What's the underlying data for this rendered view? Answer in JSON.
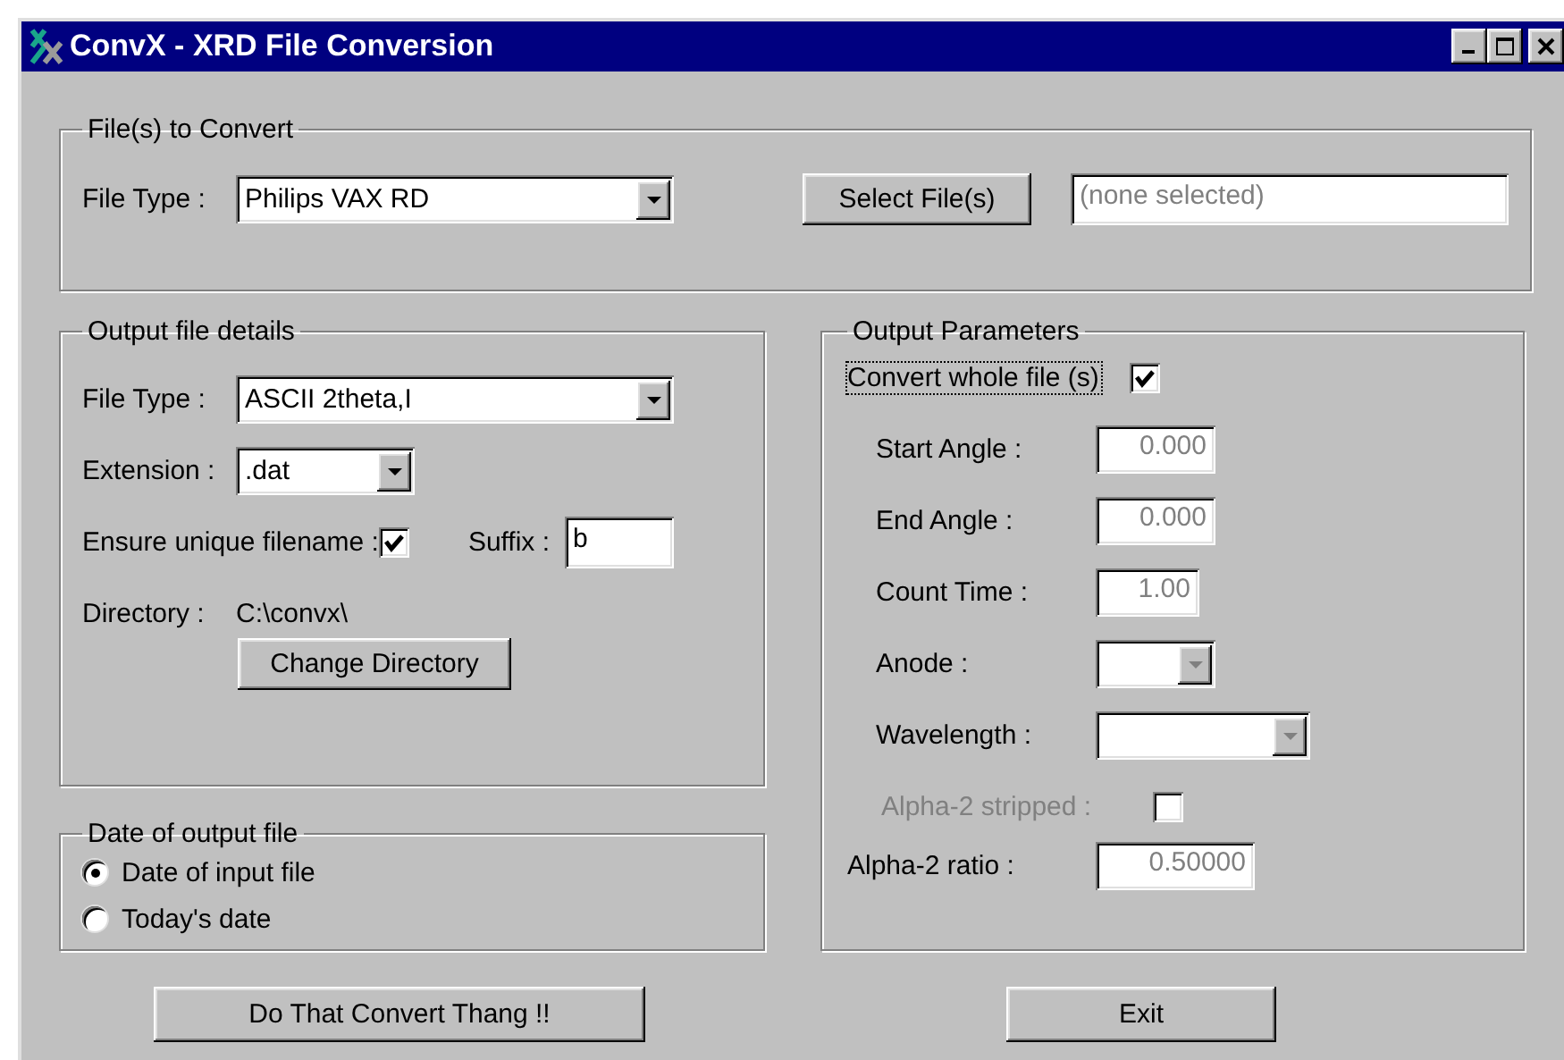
{
  "window": {
    "title": "ConvX - XRD File Conversion"
  },
  "files_to_convert": {
    "title": "File(s) to Convert",
    "file_type": {
      "label": "File Type :",
      "value": "Philips VAX RD"
    },
    "select_button": "Select File(s)",
    "selected_files": {
      "value": "(none selected)",
      "disabled": true
    }
  },
  "output_file_details": {
    "title": "Output file details",
    "file_type": {
      "label": "File Type :",
      "value": "ASCII 2theta,I"
    },
    "extension": {
      "label": "Extension :",
      "value": ".dat"
    },
    "unique_filename": {
      "label": "Ensure unique filename :",
      "checked": true
    },
    "suffix": {
      "label": "Suffix :",
      "value": "b"
    },
    "directory": {
      "label": "Directory :",
      "value": "C:\\convx\\"
    },
    "change_directory_button": "Change Directory"
  },
  "date_of_output_file": {
    "title": "Date of output file",
    "options": [
      {
        "label": "Date of input file",
        "selected": true
      },
      {
        "label": "Today's date",
        "selected": false
      }
    ]
  },
  "output_parameters": {
    "title": "Output Parameters",
    "rows": [
      {
        "kind": "checkbox",
        "label": "Convert whole file (s)",
        "checked": true,
        "focused": true,
        "disabled": false
      },
      {
        "kind": "text",
        "label": "Start Angle :",
        "value": "0.000",
        "disabled": true
      },
      {
        "kind": "text",
        "label": "End Angle :",
        "value": "0.000",
        "disabled": true
      },
      {
        "kind": "text",
        "label": "Count  Time :",
        "value": "1.00",
        "disabled": true
      },
      {
        "kind": "dropdown",
        "label": "Anode :",
        "disabled": true
      },
      {
        "kind": "dropdown",
        "label": "Wavelength :",
        "disabled": true
      },
      {
        "kind": "checkbox",
        "label": "Alpha-2 stripped :",
        "checked": false,
        "focused": false,
        "disabled": true
      },
      {
        "kind": "text",
        "label": "Alpha-2 ratio :",
        "value": "0.50000",
        "disabled": true
      }
    ]
  },
  "buttons": [
    "Do That Convert Thang !!",
    "Exit"
  ]
}
